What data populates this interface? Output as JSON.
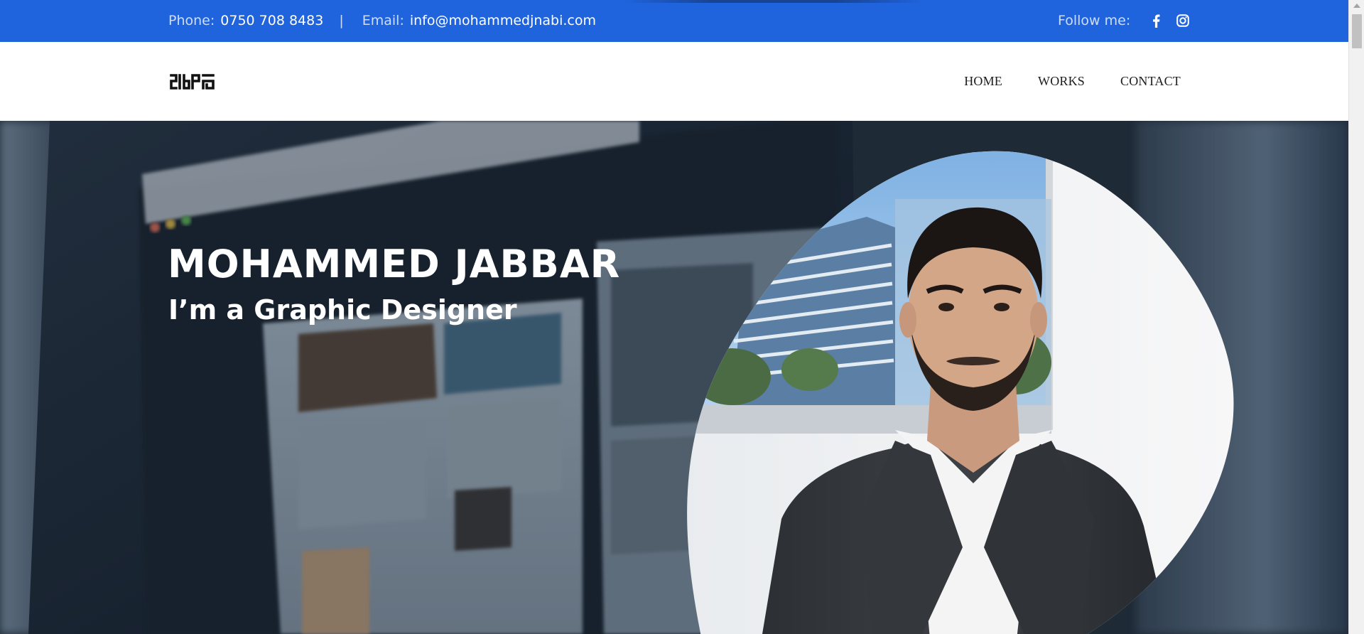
{
  "topbar": {
    "phone_label": "Phone:",
    "phone_value": "0750 708 8483",
    "separator": "|",
    "email_label": "Email:",
    "email_value": "info@mohammedjnabi.com",
    "follow_label": "Follow me:",
    "social_icons": [
      "facebook-icon",
      "instagram-icon"
    ]
  },
  "nav": {
    "items": [
      {
        "label": "HOME"
      },
      {
        "label": "WORKS"
      },
      {
        "label": "CONTACT"
      }
    ]
  },
  "hero": {
    "title": "MOHAMMED JABBAR",
    "subtitle": "I’m a Graphic Designer"
  },
  "colors": {
    "topbar_bg": "#1f63dd",
    "nav_text": "#1d1d1d",
    "hero_text": "#ffffff"
  }
}
